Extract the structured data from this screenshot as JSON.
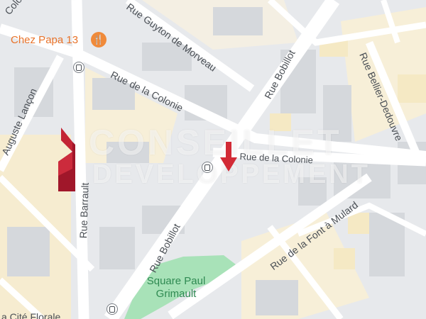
{
  "map": {
    "streets": [
      {
        "id": "guyton",
        "label": "Rue Guyton de Morveau"
      },
      {
        "id": "colonie1",
        "label": "Rue de la Colonie"
      },
      {
        "id": "colonie2",
        "label": "Rue de la Colonie"
      },
      {
        "id": "colonie3",
        "label": "Colonie"
      },
      {
        "id": "bobillot1",
        "label": "Rue Bobillot"
      },
      {
        "id": "bobillot2",
        "label": "Rue Bobillot"
      },
      {
        "id": "barrault",
        "label": "Rue Barrault"
      },
      {
        "id": "lancon",
        "label": "Auguste Lançon"
      },
      {
        "id": "bellier",
        "label": "Rue Bellier-Dedouvre"
      },
      {
        "id": "fontamulard",
        "label": "Rue de la Font à Mulard"
      },
      {
        "id": "citeflorale",
        "label": "a Cité Florale"
      }
    ],
    "poi": {
      "restaurant": "Chez Papa 13"
    },
    "park": {
      "line1": "Square Paul",
      "line2": "Grimault"
    },
    "watermark": {
      "line1": "CONSEILLET",
      "line2": "DEVELOPPEMENT"
    },
    "colors": {
      "road": "#ffffff",
      "major_road": "#ffffff",
      "block": "#dfe2e6",
      "building": "#cdd1d6",
      "yellow_block": "#fcf3da",
      "park": "#a8e2b8",
      "marker": "#b0192a",
      "poi": "#e8732a"
    },
    "icons": [
      "bus-stop-icon",
      "restaurant-icon",
      "location-marker-icon"
    ]
  }
}
